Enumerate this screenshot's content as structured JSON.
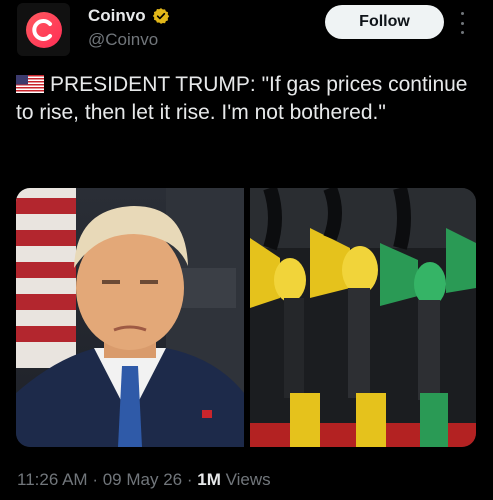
{
  "author": {
    "display_name": "Coinvo",
    "handle": "@Coinvo",
    "verified": true
  },
  "follow_label": "Follow",
  "tweet": {
    "text": "PRESIDENT TRUMP: \"If gas prices continue to rise, then let it rise. I'm not bothered.\""
  },
  "meta": {
    "time": "11:26 AM",
    "date": "09 May 26",
    "views_count": "1M",
    "views_label": "Views",
    "separator": "·"
  },
  "colors": {
    "background": "#000000",
    "text_primary": "#e7e9ea",
    "text_secondary": "#71767b",
    "verified_gold": "#e2b719",
    "follow_bg": "#eff3f4"
  }
}
